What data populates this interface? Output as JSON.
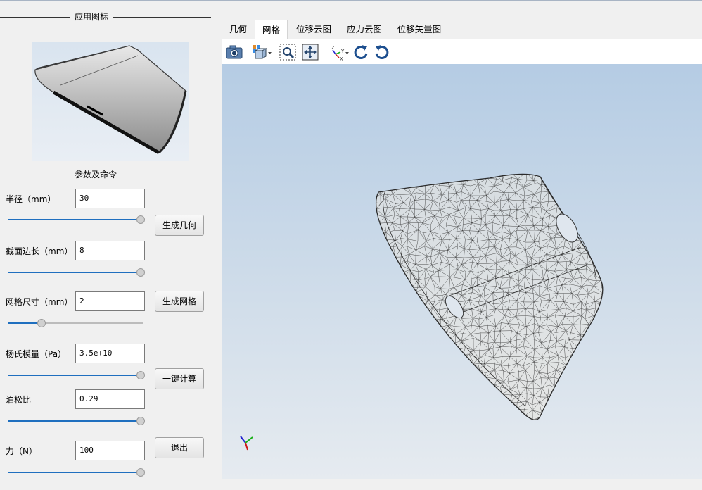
{
  "left_panel": {
    "app_icon_group_title": "应用图标",
    "params_group_title": "参数及命令",
    "params": [
      {
        "label": "半径（mm）",
        "value": "30",
        "slider_fraction": 1.0
      },
      {
        "label": "截面边长（mm）",
        "value": "8",
        "slider_fraction": 1.0
      },
      {
        "label": "网格尺寸（mm）",
        "value": "2",
        "slider_fraction": 0.25
      },
      {
        "label": "杨氏模量（Pa）",
        "value": "3.5e+10",
        "slider_fraction": 1.0
      },
      {
        "label": "泊松比",
        "value": "0.29",
        "slider_fraction": 1.0
      },
      {
        "label": "力（N）",
        "value": "100",
        "slider_fraction": 1.0
      }
    ],
    "buttons": {
      "generate_geometry": "生成几何",
      "generate_mesh": "生成网格",
      "one_click_compute": "一键计算",
      "exit": "退出"
    }
  },
  "tabs": [
    "几何",
    "网格",
    "位移云图",
    "应力云图",
    "位移矢量图"
  ],
  "active_tab": "网格",
  "toolbar_icons": [
    "camera-icon",
    "view-cube-icon",
    "zoom-box-icon",
    "pan-fit-icon",
    "axes-icon",
    "rotate-cw-icon",
    "rotate-ccw-icon"
  ],
  "colors": {
    "slider_fill": "#1f6fbf",
    "viewport_top": "#b5cce4",
    "viewport_bottom": "#e6ebf0",
    "mesh": "#3a3a3a",
    "axis_x": "#d01818",
    "axis_y": "#18b018",
    "axis_z": "#2020d0"
  }
}
